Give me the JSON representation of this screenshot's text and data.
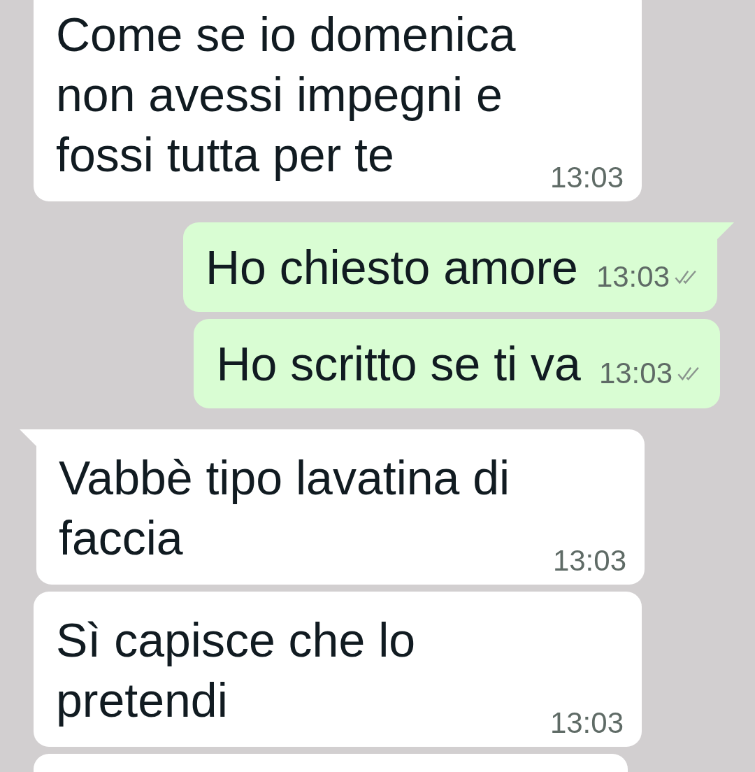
{
  "messages": [
    {
      "kind": "in",
      "tail": false,
      "text": "Come se io domenica\nnon avessi impegni e\nfossi tutta per te",
      "time": "13:03"
    },
    {
      "kind": "out",
      "tail": true,
      "text": "Ho chiesto amore",
      "time": "13:03",
      "read": false
    },
    {
      "kind": "out",
      "tail": false,
      "text": "Ho scritto se ti va",
      "time": "13:03",
      "read": false
    },
    {
      "kind": "in",
      "tail": true,
      "text": "Vabbè tipo lavatina di\nfaccia",
      "time": "13:03"
    },
    {
      "kind": "in",
      "tail": false,
      "text": "Sì capisce che lo\npretendi",
      "time": "13:03"
    },
    {
      "kind": "in",
      "tail": false
    }
  ]
}
